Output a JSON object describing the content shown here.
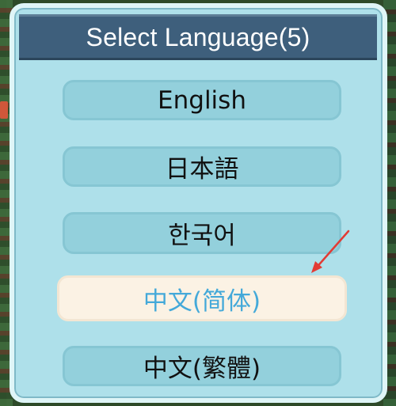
{
  "dialog": {
    "title": "Select Language(5)"
  },
  "languages": [
    {
      "label": "English",
      "selected": false
    },
    {
      "label": "日本語",
      "selected": false
    },
    {
      "label": "한국어",
      "selected": false
    },
    {
      "label": "中文(简体)",
      "selected": true
    },
    {
      "label": "中文(繁體)",
      "selected": false
    }
  ],
  "colors": {
    "panel": "#aee0ea",
    "header": "#3e5f7c",
    "button": "#93d0dc",
    "selected_button": "#fbf2e4",
    "selected_text": "#44a9d9",
    "annotation_arrow": "#e23b35"
  },
  "icons": {
    "annotation": "red-arrow-icon"
  }
}
